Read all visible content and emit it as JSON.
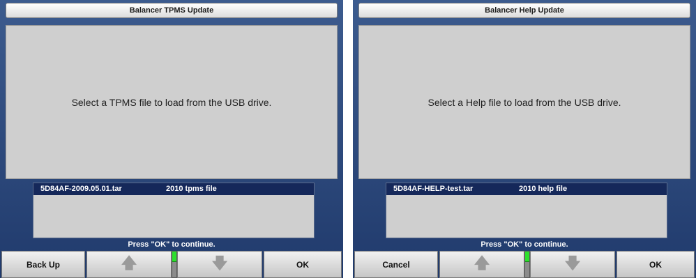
{
  "screens": [
    {
      "title": "Balancer TPMS Update",
      "message": "Select a TPMS file to load from the USB drive.",
      "files": [
        {
          "name": "5D84AF-2009.05.01.tar",
          "desc": "2010 tpms file"
        }
      ],
      "hint": "Press \"OK\" to continue.",
      "buttons": {
        "b1": "Back Up",
        "b2_icon": "up-arrow-icon",
        "b3_icon": "down-arrow-icon",
        "b4": "OK"
      }
    },
    {
      "title": "Balancer Help Update",
      "message": "Select a Help file to load from the USB drive.",
      "files": [
        {
          "name": "5D84AF-HELP-test.tar",
          "desc": "2010 help file"
        }
      ],
      "hint": "Press \"OK\" to continue.",
      "buttons": {
        "b1": "Cancel",
        "b2_icon": "up-arrow-icon",
        "b3_icon": "down-arrow-icon",
        "b4": "OK"
      }
    }
  ],
  "theme": {
    "background": "#203a6c",
    "selected_row": "#15285a",
    "slider_thumb": "#2de02d"
  }
}
